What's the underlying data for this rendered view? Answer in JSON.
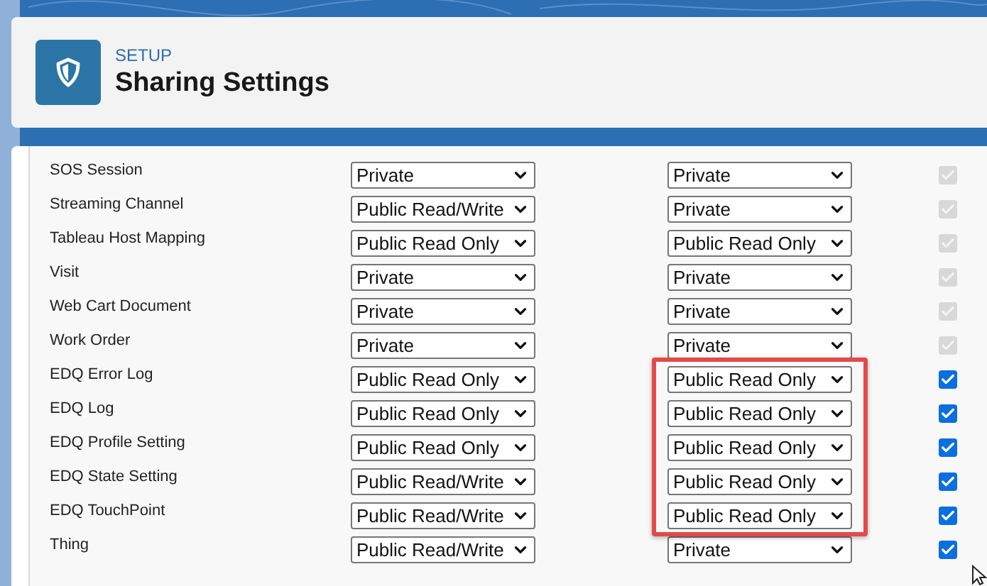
{
  "header": {
    "breadcrumb": "SETUP",
    "title": "Sharing Settings"
  },
  "rows": [
    {
      "name": "SOS Session",
      "default_internal": "Private",
      "default_external": "Private",
      "checked": true,
      "disabled": true,
      "highlighted": false
    },
    {
      "name": "Streaming Channel",
      "default_internal": "Public Read/Write",
      "default_external": "Private",
      "checked": true,
      "disabled": true,
      "highlighted": false
    },
    {
      "name": "Tableau Host Mapping",
      "default_internal": "Public Read Only",
      "default_external": "Public Read Only",
      "checked": true,
      "disabled": true,
      "highlighted": false
    },
    {
      "name": "Visit",
      "default_internal": "Private",
      "default_external": "Private",
      "checked": true,
      "disabled": true,
      "highlighted": false
    },
    {
      "name": "Web Cart Document",
      "default_internal": "Private",
      "default_external": "Private",
      "checked": true,
      "disabled": true,
      "highlighted": false
    },
    {
      "name": "Work Order",
      "default_internal": "Private",
      "default_external": "Private",
      "checked": true,
      "disabled": true,
      "highlighted": false
    },
    {
      "name": "EDQ Error Log",
      "default_internal": "Public Read Only",
      "default_external": "Public Read Only",
      "checked": true,
      "disabled": false,
      "highlighted": true
    },
    {
      "name": "EDQ Log",
      "default_internal": "Public Read Only",
      "default_external": "Public Read Only",
      "checked": true,
      "disabled": false,
      "highlighted": true
    },
    {
      "name": "EDQ Profile Setting",
      "default_internal": "Public Read Only",
      "default_external": "Public Read Only",
      "checked": true,
      "disabled": false,
      "highlighted": true
    },
    {
      "name": "EDQ State Setting",
      "default_internal": "Public Read/Write",
      "default_external": "Public Read Only",
      "checked": true,
      "disabled": false,
      "highlighted": true
    },
    {
      "name": "EDQ TouchPoint",
      "default_internal": "Public Read/Write",
      "default_external": "Public Read Only",
      "checked": true,
      "disabled": false,
      "highlighted": true
    },
    {
      "name": "Thing",
      "default_internal": "Public Read/Write",
      "default_external": "Private",
      "checked": true,
      "disabled": false,
      "highlighted": false
    }
  ]
}
